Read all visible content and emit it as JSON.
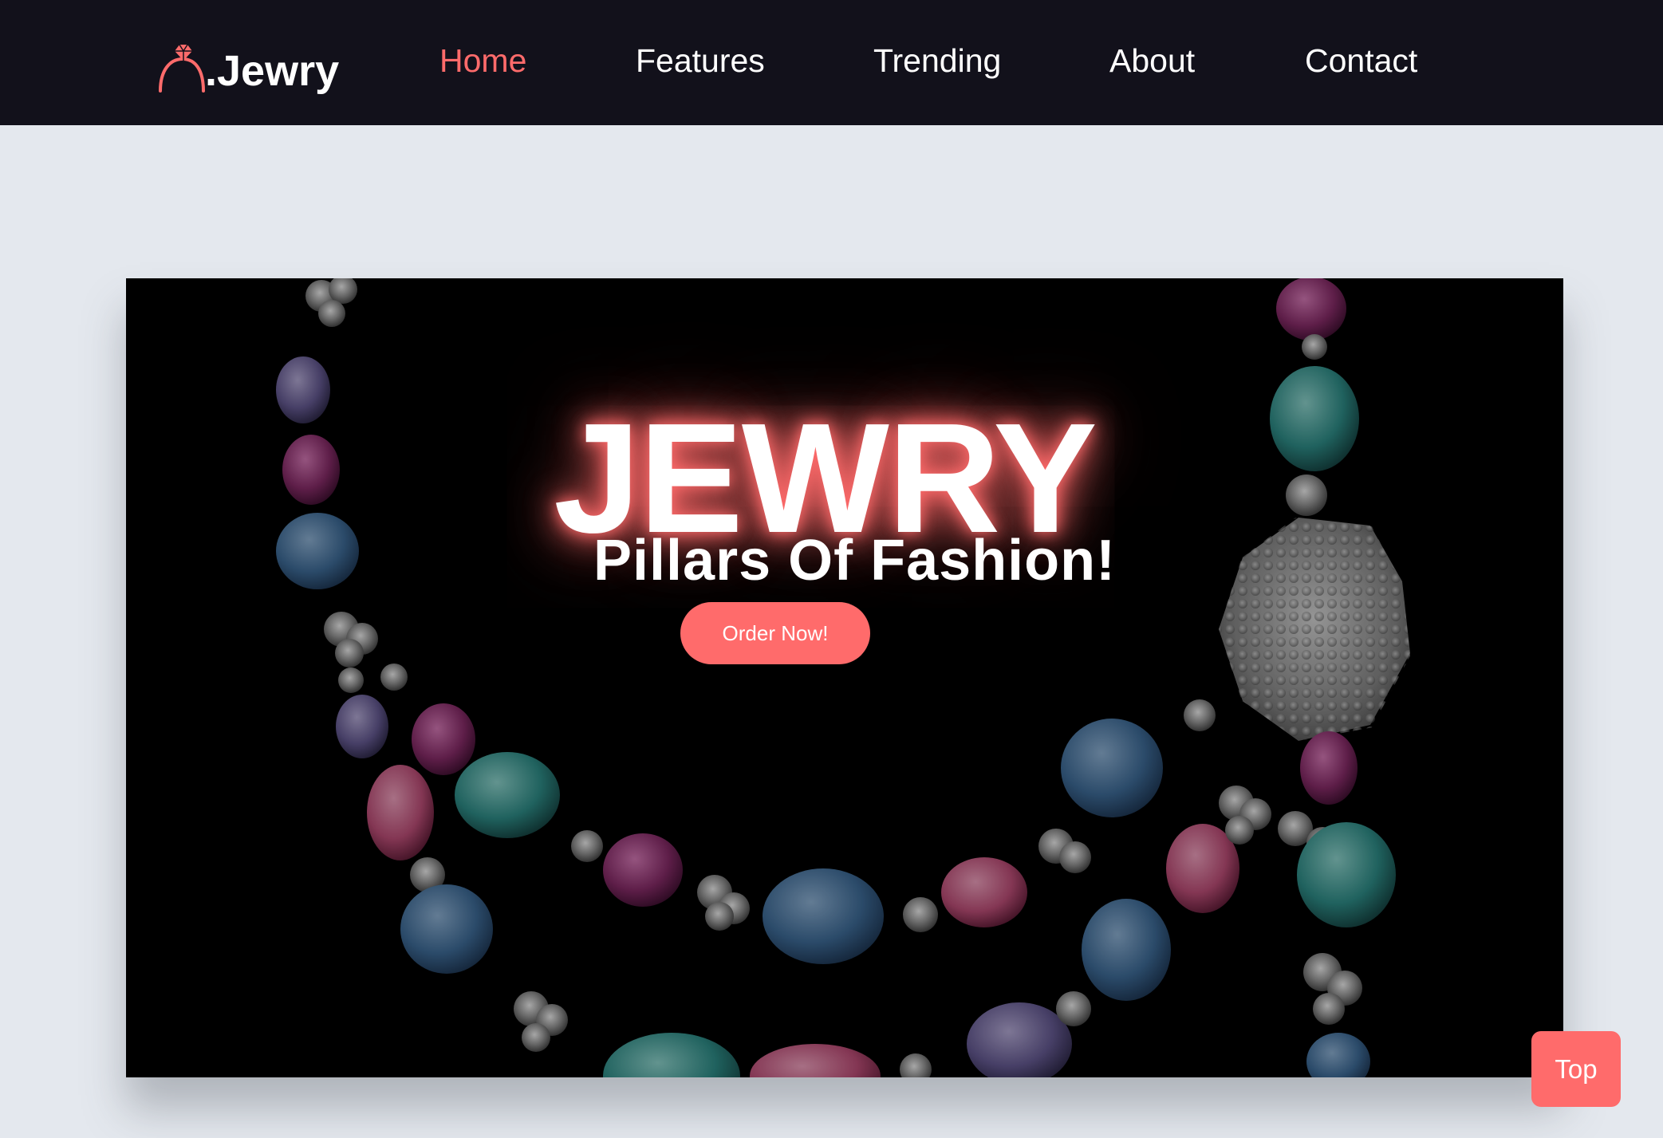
{
  "brand": {
    "name": ".Jewry",
    "icon": "diamond-ring-icon",
    "accent_color": "#ff6b6b"
  },
  "nav": {
    "links": [
      {
        "label": "Home",
        "active": true
      },
      {
        "label": "Features",
        "active": false
      },
      {
        "label": "Trending",
        "active": false
      },
      {
        "label": "About",
        "active": false
      },
      {
        "label": "Contact",
        "active": false
      }
    ]
  },
  "hero": {
    "title": "JEWRY",
    "subtitle": "Pillars Of Fashion!",
    "cta_label": "Order Now!",
    "background": "gemstone-necklace-image"
  },
  "scroll_top": {
    "label": "Top"
  },
  "colors": {
    "navbar": "#12111b",
    "page_background": "#e4e8ee",
    "accent": "#ff6b6b"
  }
}
